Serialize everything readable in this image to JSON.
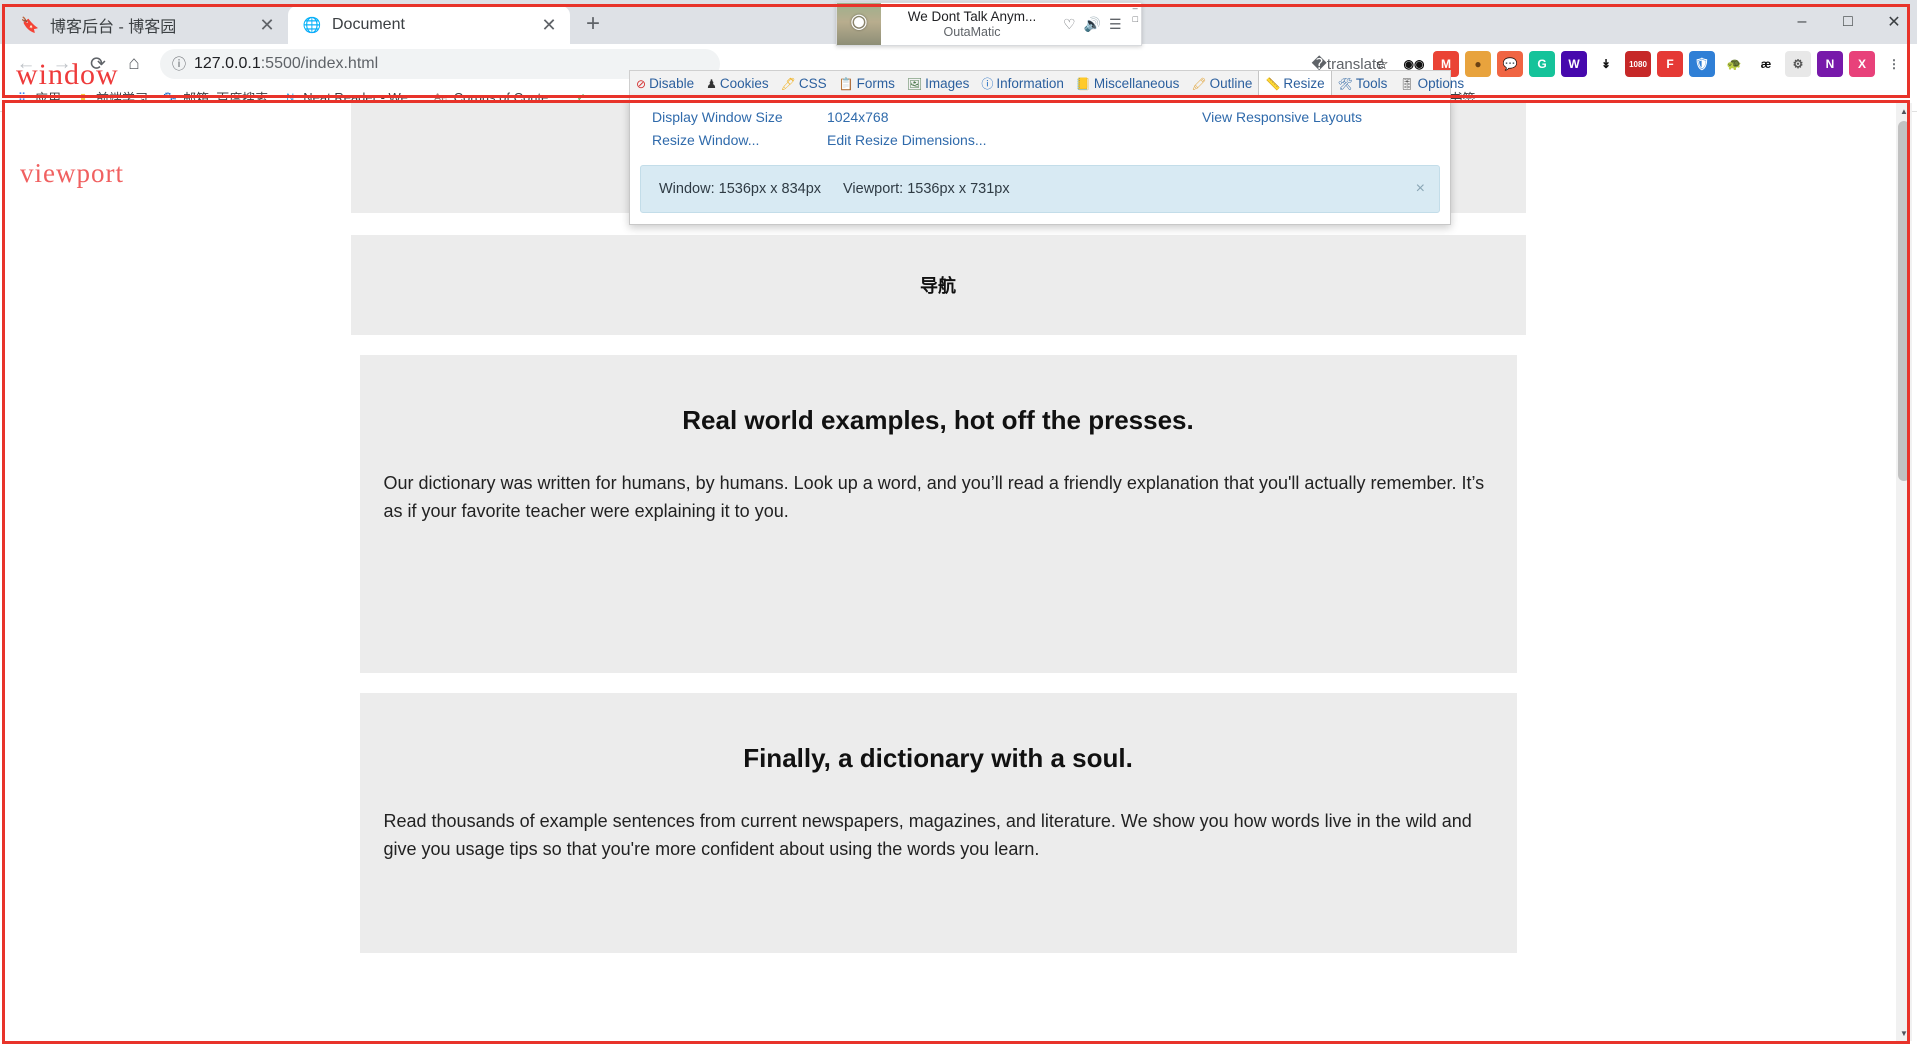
{
  "browser": {
    "tabs": [
      {
        "title": "博客后台 - 博客园",
        "favicon": "bookmark-favicon",
        "active": false
      },
      {
        "title": "Document",
        "favicon": "globe-favicon",
        "active": true
      }
    ],
    "new_tab_label": "+",
    "window_controls": {
      "minimize": "–",
      "maximize": "□",
      "close": "✕"
    },
    "nav": {
      "back": "←",
      "forward": "→",
      "reload": "⟳",
      "home": "⌂"
    },
    "omnibox": {
      "info_icon": "ⓘ",
      "url_host": "127.0.0.1",
      "url_path": ":5500/index.html",
      "url_full": "127.0.0.1:5500/index.html",
      "translate_icon": "translate-icon",
      "bookmark_icon": "☆"
    },
    "toolbar_extensions": [
      {
        "name": "extension-panda",
        "glyph": "◉◉",
        "color": "#ffffff",
        "text_color": "#111111"
      },
      {
        "name": "extension-gmail",
        "glyph": "M",
        "color": "#ea4335",
        "text_color": "#ffffff"
      },
      {
        "name": "extension-cookie",
        "glyph": "●",
        "color": "#e8a33d",
        "text_color": "#6b4214"
      },
      {
        "name": "extension-chat",
        "glyph": "💬",
        "color": "#f06543",
        "text_color": "#ffffff"
      },
      {
        "name": "extension-grammarly",
        "glyph": "G",
        "color": "#15c39a",
        "text_color": "#ffffff"
      },
      {
        "name": "extension-wappalyzer",
        "glyph": "W",
        "color": "#4608ad",
        "text_color": "#ffffff"
      },
      {
        "name": "extension-download",
        "glyph": "↡",
        "color": "#ffffff",
        "text_color": "#111111"
      },
      {
        "name": "extension-1080",
        "glyph": "1080",
        "color": "#c62828",
        "text_color": "#ffffff"
      },
      {
        "name": "extension-foxit",
        "glyph": "F",
        "color": "#e53935",
        "text_color": "#ffffff"
      },
      {
        "name": "extension-shield",
        "glyph": "🛡",
        "color": "#2f7fd6",
        "text_color": "#ffffff"
      },
      {
        "name": "extension-turtle",
        "glyph": "🐢",
        "color": "#ffffff",
        "text_color": "#2e7d32"
      },
      {
        "name": "extension-ae",
        "glyph": "æ",
        "color": "#ffffff",
        "text_color": "#111111"
      },
      {
        "name": "extension-gear",
        "glyph": "⚙",
        "color": "#e8e8e8",
        "text_color": "#555555"
      },
      {
        "name": "extension-onenote",
        "glyph": "N",
        "color": "#7719aa",
        "text_color": "#ffffff"
      },
      {
        "name": "profile-avatar",
        "glyph": "X",
        "color": "#e8417a",
        "text_color": "#ffffff"
      },
      {
        "name": "chrome-menu",
        "glyph": "⋮",
        "color": "#ffffff",
        "text_color": "#5f6368"
      }
    ],
    "bookmarks": [
      {
        "label": "应用",
        "icon": "apps-grid-icon",
        "icon_color": "#4285f4",
        "glyph": "⠿"
      },
      {
        "label": "前端学习",
        "icon": "folder-icon",
        "icon_color": "#f7c744",
        "glyph": "▮"
      },
      {
        "label": "邮箱_百度搜索",
        "icon": "baidu-icon",
        "icon_color": "#2932e1",
        "glyph": "🐾"
      },
      {
        "label": "Neat Reader - We...",
        "icon": "neat-reader-icon",
        "icon_color": "#2d9cdb",
        "glyph": "N"
      },
      {
        "label": "Corpus of Conte...",
        "icon": "corpus-icon",
        "icon_color": "#8d6e63",
        "glyph": "Ae"
      },
      {
        "label": "",
        "icon": "checkmark-icon",
        "icon_color": "#4caf50",
        "glyph": "✓"
      }
    ],
    "bookmarks_overflow": "»",
    "other_bookmarks": {
      "label": "其他书签",
      "icon": "folder-icon",
      "glyph": "▮"
    }
  },
  "media_player": {
    "title": "We Dont Talk Anym...",
    "artist": "OutaMatic",
    "album_art": "album-art-thumbnail",
    "heart_icon": "♡",
    "cast_icon": "🔊",
    "list_icon": "☰",
    "minimize": "‒",
    "close": "□"
  },
  "annotations": {
    "window_label": "window",
    "viewport_label": "viewport",
    "frame_color": "#e8332a",
    "window_text_color": "#ee3b3b",
    "viewport_text_color": "#f06060"
  },
  "webdev": {
    "items": [
      {
        "label": "Disable",
        "icon": "disable-icon",
        "glyph": "⊘",
        "color": "#d32f2f",
        "active": false
      },
      {
        "label": "Cookies",
        "icon": "cookies-icon",
        "glyph": "♟",
        "color": "#333333",
        "active": false
      },
      {
        "label": "CSS",
        "icon": "css-icon",
        "glyph": "🖊",
        "color": "#f0b429",
        "active": false
      },
      {
        "label": "Forms",
        "icon": "forms-icon",
        "glyph": "📋",
        "color": "#d97706",
        "active": false
      },
      {
        "label": "Images",
        "icon": "images-icon",
        "glyph": "🖼",
        "color": "#4e7a4e",
        "active": false
      },
      {
        "label": "Information",
        "icon": "information-icon",
        "glyph": "ⓘ",
        "color": "#1565c0",
        "active": false
      },
      {
        "label": "Miscellaneous",
        "icon": "miscellaneous-icon",
        "glyph": "📒",
        "color": "#d4951c",
        "active": false
      },
      {
        "label": "Outline",
        "icon": "outline-icon",
        "glyph": "🖍",
        "color": "#e0a030",
        "active": false
      },
      {
        "label": "Resize",
        "icon": "resize-icon",
        "glyph": "📏",
        "color": "#e0a030",
        "active": true
      },
      {
        "label": "Tools",
        "icon": "tools-icon",
        "glyph": "🛠",
        "color": "#3b6fa8",
        "active": false
      },
      {
        "label": "Options",
        "icon": "options-icon",
        "glyph": "🎚",
        "color": "#555555",
        "active": false
      }
    ],
    "panel": {
      "display_window_size": "Display Window Size",
      "preset_size": "1024x768",
      "view_responsive_layouts": "View Responsive Layouts",
      "resize_window": "Resize Window...",
      "edit_resize_dimensions": "Edit Resize Dimensions...",
      "banner": {
        "window_size": "Window: 1536px x 834px",
        "viewport_size": "Viewport: 1536px x 731px",
        "close": "×"
      }
    }
  },
  "content": {
    "nav_title": "导航",
    "sections": [
      {
        "heading": "Real world examples, hot off the presses.",
        "paragraph": "Our dictionary was written for humans, by humans. Look up a word, and you’ll read a friendly explanation that you'll actually remember. It’s as if your favorite teacher were explaining it to you."
      },
      {
        "heading": "Finally, a dictionary with a soul.",
        "paragraph": "Read thousands of example sentences from current newspapers, magazines, and literature. We show you how words live in the wild and give you usage tips so that you're more confident about using the words you learn."
      }
    ]
  },
  "scrollbar": {
    "up_arrow": "▲",
    "down_arrow": "▼"
  }
}
